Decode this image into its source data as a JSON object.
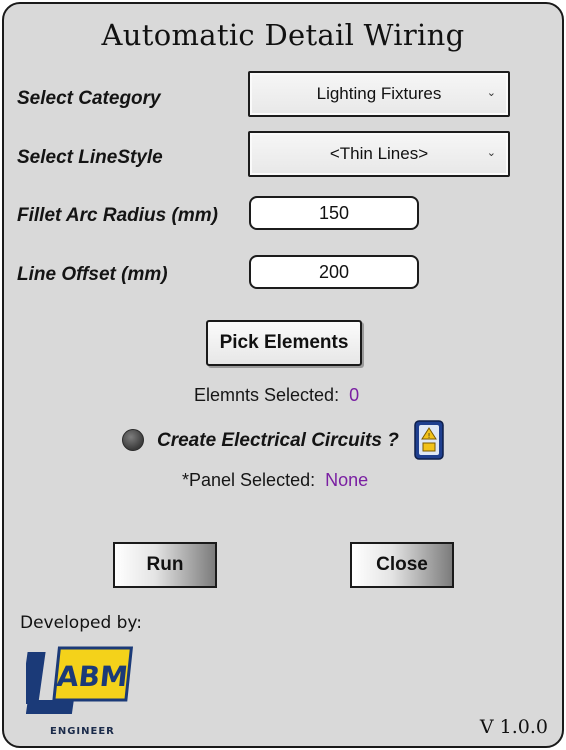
{
  "window": {
    "title": "Automatic Detail Wiring"
  },
  "form": {
    "category_label": "Select Category",
    "category_value": "Lighting Fixtures",
    "linestyle_label": "Select LineStyle",
    "linestyle_value": "<Thin Lines>",
    "fillet_label": "Fillet Arc Radius (mm)",
    "fillet_value": "150",
    "offset_label": "Line Offset (mm)",
    "offset_value": "200"
  },
  "pick": {
    "button_label": "Pick Elements",
    "selected_label": "Elemnts Selected:",
    "selected_count": "0"
  },
  "circuits": {
    "option_label": "Create Electrical Circuits ?",
    "panel_label": "*Panel Selected:",
    "panel_value": "None"
  },
  "actions": {
    "run_label": "Run",
    "close_label": "Close"
  },
  "footer": {
    "developed_by": "Developed by:",
    "logo_text": "ABM",
    "logo_subtext": "ENGINEER",
    "version": "V 1.0.0"
  },
  "colors": {
    "background": "#d9d9d9",
    "accent_value": "#7a1fa2",
    "border": "#1a1a1a"
  },
  "icons": {
    "dropdown": "chevron-down-icon",
    "panel": "electrical-panel-icon",
    "radio": "radio-button-icon"
  }
}
